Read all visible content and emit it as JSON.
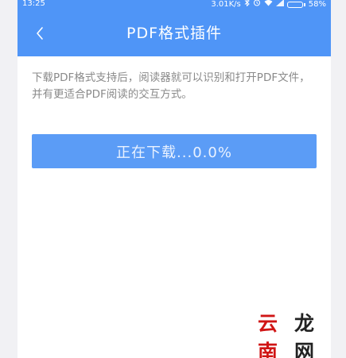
{
  "status_bar": {
    "time": "13:25",
    "network_speed": "3.01K/s",
    "battery_percent": "58%",
    "battery_level": 0.58,
    "icons": [
      "bluetooth-icon",
      "alarm-icon",
      "wifi-icon",
      "signal-icon",
      "battery-icon"
    ]
  },
  "header": {
    "title": "PDF格式插件",
    "back_icon": "chevron-left-icon"
  },
  "main": {
    "description": "下载PDF格式支持后，阅读器就可以识别和打开PDF文件，并有更适合PDF阅读的交互方式。",
    "download_button_label": "正在下载...0.0%",
    "download_progress_percent": 0.0
  },
  "watermark": {
    "text_part1": "云南",
    "text_part2": "龙网"
  },
  "colors": {
    "accent": "#4f95f7",
    "button": "#5b9cf6",
    "description_text": "#8a8a8a",
    "background": "#f1f1f4"
  }
}
